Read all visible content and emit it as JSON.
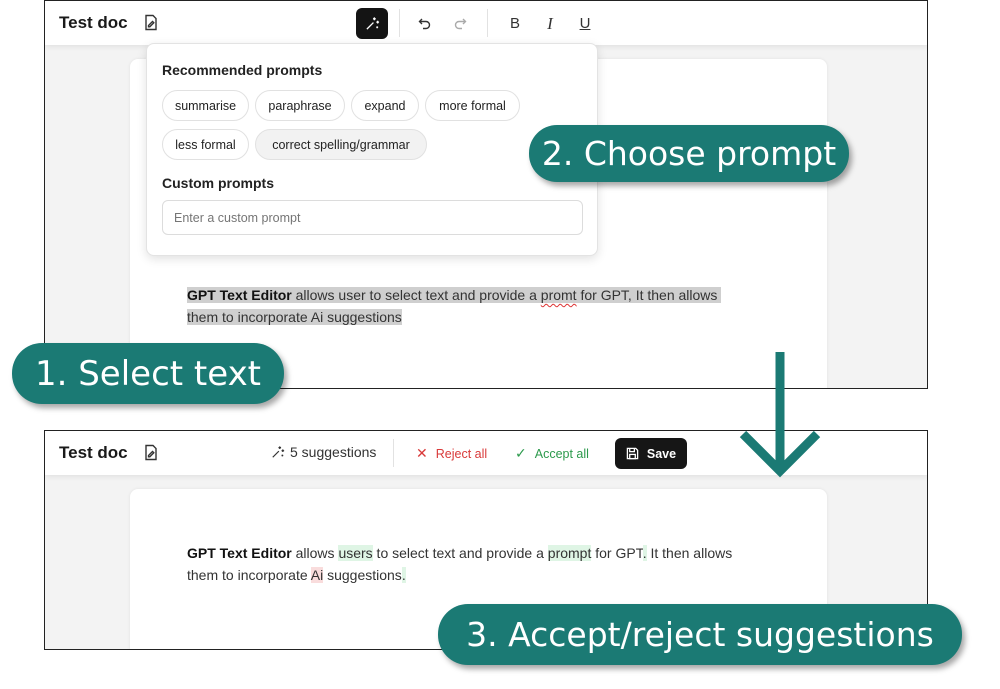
{
  "top_editor": {
    "title": "Test doc",
    "toolbar": {
      "ai_button": "ai-sparkle-icon",
      "undo": "undo-icon",
      "redo": "redo-icon",
      "bold": "B",
      "italic": "I",
      "underline": "U"
    },
    "popover": {
      "recommended_heading": "Recommended prompts",
      "chips": [
        "summarise",
        "paraphrase",
        "expand",
        "more formal",
        "less formal",
        "correct spelling/grammar"
      ],
      "custom_heading": "Custom prompts",
      "custom_placeholder": "Enter a custom prompt"
    },
    "text": {
      "bold": "GPT Text Editor",
      "part1": " allows user to select text and provide a ",
      "misspelled": "promt",
      "part2": " for GPT, It then allows",
      "line2": "them to incorporate Ai suggestions"
    }
  },
  "bottom_editor": {
    "title": "Test doc",
    "suggestions_count": "5 suggestions",
    "reject_all": "Reject all",
    "accept_all": "Accept all",
    "save": "Save",
    "text": {
      "bold": "GPT Text Editor",
      "s1": " allows ",
      "ins1": "users",
      "s2": " to select text and provide a ",
      "ins2": "prompt",
      "s3": " for GPT",
      "ins3": ".",
      "s4": " It then allows",
      "l2a": "them to incorporate ",
      "del1": "Ai",
      "l2b": " suggestions",
      "ins4": "."
    }
  },
  "callouts": {
    "select": "1. Select text",
    "choose": "2. Choose prompt",
    "accept": "3. Accept/reject suggestions"
  },
  "colors": {
    "callout_bg": "#1b7a74",
    "arrow": "#1b7a74",
    "insert_highlight": "#dff5e5",
    "delete_highlight": "#f9dcdc",
    "reject": "#d93a3a",
    "accept": "#2c9a4c"
  }
}
